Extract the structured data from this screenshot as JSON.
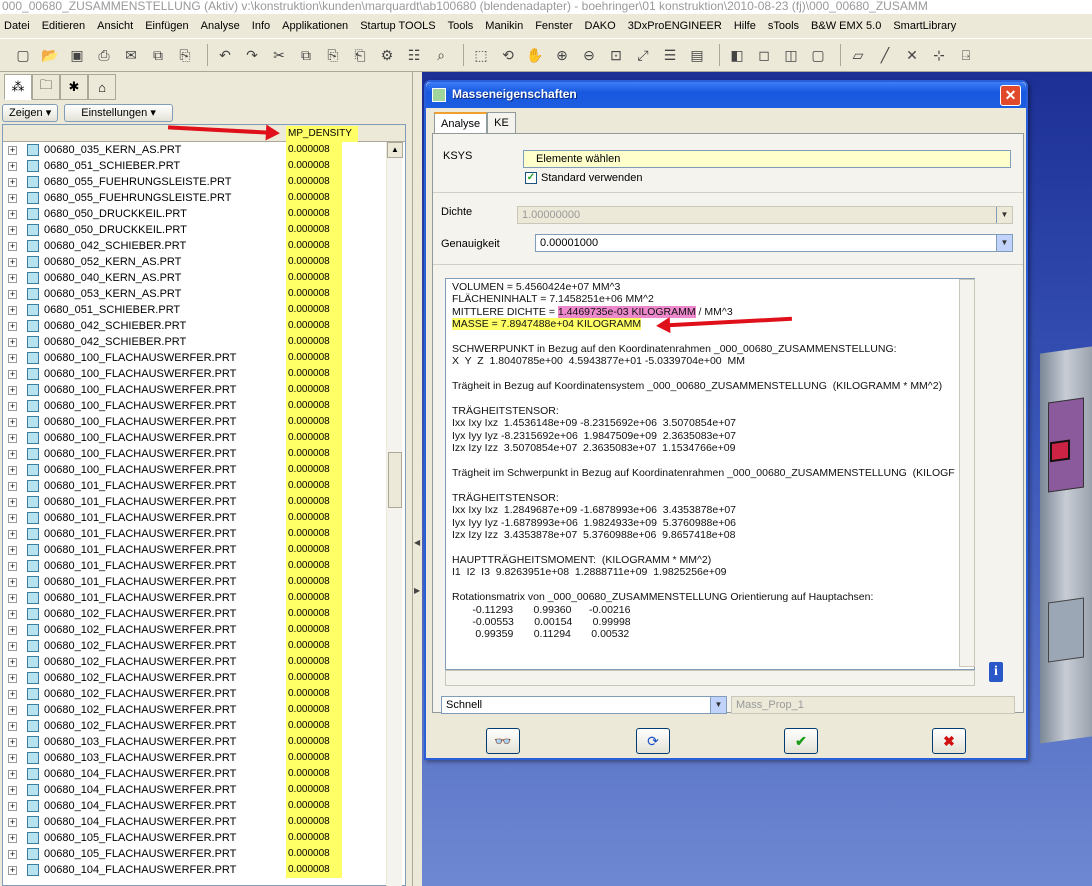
{
  "window": {
    "title": "000_00680_ZUSAMMENSTELLUNG (Aktiv) v:\\konstruktion\\kunden\\marquardt\\ab100680 (blendenadapter) - boehringer\\01 konstruktion\\2010-08-23 (fj)\\000_00680_ZUSAMM"
  },
  "menu": [
    "Datei",
    "Editieren",
    "Ansicht",
    "Einfügen",
    "Analyse",
    "Info",
    "Applikationen",
    "Startup TOOLS",
    "Tools",
    "Manikin",
    "Fenster",
    "DAKO",
    "3DxProENGINEER",
    "Hilfe",
    "sTools",
    "B&W EMX 5.0",
    "SmartLibrary"
  ],
  "toolbar_icons": [
    "new-icon",
    "open-icon",
    "save-icon",
    "print-icon",
    "send-icon",
    "copy-icon",
    "paste-icon",
    "undo-icon",
    "redo-icon",
    "cut-icon",
    "copy2-icon",
    "paste2-icon",
    "paste-special-icon",
    "regen-icon",
    "model-tree-icon",
    "binoculars-icon",
    "select-icon",
    "spin-icon",
    "pan-icon",
    "zoom-in-icon",
    "zoom-out-icon",
    "zoom-box-icon",
    "refit-icon",
    "layers-icon",
    "views-icon",
    "shading-icon",
    "wireframe-icon",
    "hidden-icon",
    "no-hidden-icon",
    "datum-plane-icon",
    "datum-axis-icon",
    "datum-point-icon",
    "csys-icon",
    "annotation-icon"
  ],
  "left": {
    "show_label": "Zeigen",
    "settings_label": "Einstellungen",
    "column_header": "MP_DENSITY",
    "rows": [
      {
        "name": "00680_035_KERN_AS.PRT",
        "value": "0.000008"
      },
      {
        "name": "0680_051_SCHIEBER.PRT",
        "value": "0.000008"
      },
      {
        "name": "0680_055_FUEHRUNGSLEISTE.PRT",
        "value": "0.000008"
      },
      {
        "name": "0680_055_FUEHRUNGSLEISTE.PRT",
        "value": "0.000008"
      },
      {
        "name": "0680_050_DRUCKKEIL.PRT",
        "value": "0.000008"
      },
      {
        "name": "0680_050_DRUCKKEIL.PRT",
        "value": "0.000008"
      },
      {
        "name": "00680_042_SCHIEBER.PRT",
        "value": "0.000008"
      },
      {
        "name": "00680_052_KERN_AS.PRT",
        "value": "0.000008"
      },
      {
        "name": "00680_040_KERN_AS.PRT",
        "value": "0.000008"
      },
      {
        "name": "00680_053_KERN_AS.PRT",
        "value": "0.000008"
      },
      {
        "name": "0680_051_SCHIEBER.PRT",
        "value": "0.000008"
      },
      {
        "name": "00680_042_SCHIEBER.PRT",
        "value": "0.000008"
      },
      {
        "name": "00680_042_SCHIEBER.PRT",
        "value": "0.000008"
      },
      {
        "name": "00680_100_FLACHAUSWERFER.PRT",
        "value": "0.000008"
      },
      {
        "name": "00680_100_FLACHAUSWERFER.PRT",
        "value": "0.000008"
      },
      {
        "name": "00680_100_FLACHAUSWERFER.PRT",
        "value": "0.000008"
      },
      {
        "name": "00680_100_FLACHAUSWERFER.PRT",
        "value": "0.000008"
      },
      {
        "name": "00680_100_FLACHAUSWERFER.PRT",
        "value": "0.000008"
      },
      {
        "name": "00680_100_FLACHAUSWERFER.PRT",
        "value": "0.000008"
      },
      {
        "name": "00680_100_FLACHAUSWERFER.PRT",
        "value": "0.000008"
      },
      {
        "name": "00680_100_FLACHAUSWERFER.PRT",
        "value": "0.000008"
      },
      {
        "name": "00680_101_FLACHAUSWERFER.PRT",
        "value": "0.000008"
      },
      {
        "name": "00680_101_FLACHAUSWERFER.PRT",
        "value": "0.000008"
      },
      {
        "name": "00680_101_FLACHAUSWERFER.PRT",
        "value": "0.000008"
      },
      {
        "name": "00680_101_FLACHAUSWERFER.PRT",
        "value": "0.000008"
      },
      {
        "name": "00680_101_FLACHAUSWERFER.PRT",
        "value": "0.000008"
      },
      {
        "name": "00680_101_FLACHAUSWERFER.PRT",
        "value": "0.000008"
      },
      {
        "name": "00680_101_FLACHAUSWERFER.PRT",
        "value": "0.000008"
      },
      {
        "name": "00680_101_FLACHAUSWERFER.PRT",
        "value": "0.000008"
      },
      {
        "name": "00680_102_FLACHAUSWERFER.PRT",
        "value": "0.000008"
      },
      {
        "name": "00680_102_FLACHAUSWERFER.PRT",
        "value": "0.000008"
      },
      {
        "name": "00680_102_FLACHAUSWERFER.PRT",
        "value": "0.000008"
      },
      {
        "name": "00680_102_FLACHAUSWERFER.PRT",
        "value": "0.000008"
      },
      {
        "name": "00680_102_FLACHAUSWERFER.PRT",
        "value": "0.000008"
      },
      {
        "name": "00680_102_FLACHAUSWERFER.PRT",
        "value": "0.000008"
      },
      {
        "name": "00680_102_FLACHAUSWERFER.PRT",
        "value": "0.000008"
      },
      {
        "name": "00680_102_FLACHAUSWERFER.PRT",
        "value": "0.000008"
      },
      {
        "name": "00680_103_FLACHAUSWERFER.PRT",
        "value": "0.000008"
      },
      {
        "name": "00680_103_FLACHAUSWERFER.PRT",
        "value": "0.000008"
      },
      {
        "name": "00680_104_FLACHAUSWERFER.PRT",
        "value": "0.000008"
      },
      {
        "name": "00680_104_FLACHAUSWERFER.PRT",
        "value": "0.000008"
      },
      {
        "name": "00680_104_FLACHAUSWERFER.PRT",
        "value": "0.000008"
      },
      {
        "name": "00680_104_FLACHAUSWERFER.PRT",
        "value": "0.000008"
      },
      {
        "name": "00680_105_FLACHAUSWERFER.PRT",
        "value": "0.000008"
      },
      {
        "name": "00680_105_FLACHAUSWERFER.PRT",
        "value": "0.000008"
      },
      {
        "name": "00680_104_FLACHAUSWERFER.PRT",
        "value": "0.000008"
      }
    ]
  },
  "dialog": {
    "title": "Masseneigenschaften",
    "tabs": [
      "Analyse",
      "KE"
    ],
    "ksys_label": "KSYS",
    "ksys_value": "Elemente wählen",
    "standard_label": "Standard verwenden",
    "dichte_label": "Dichte",
    "dichte_value": "1.00000000",
    "genauigkeit_label": "Genauigkeit",
    "genauigkeit_value": "0.00001000",
    "results": {
      "l1": "VOLUMEN = 5.4560424e+07 MM^3",
      "l2": "FLÄCHENINHALT = 7.1458251e+06 MM^2",
      "l3a": "MITTLERE DICHTE = ",
      "l3b": "1.4469735e-03 KILOGRAMM",
      "l3c": " / MM^3",
      "l4a": "MASSE = ",
      "l4b": "7.8947488e+04 KILOGRAMM",
      "l5": "",
      "l6": "SCHWERPUNKT in Bezug auf den Koordinatenrahmen _000_00680_ZUSAMMENSTELLUNG:",
      "l7": "X  Y  Z  1.8040785e+00  4.5943877e+01 -5.0339704e+00  MM",
      "l8": "",
      "l9": "Trägheit in Bezug auf Koordinatensystem _000_00680_ZUSAMMENSTELLUNG  (KILOGRAMM * MM^2)",
      "l10": "",
      "l11": "TRÄGHEITSTENSOR:",
      "l12": "Ixx Ixy Ixz  1.4536148e+09 -8.2315692e+06  3.5070854e+07",
      "l13": "Iyx Iyy Iyz -8.2315692e+06  1.9847509e+09  2.3635083e+07",
      "l14": "Izx Izy Izz  3.5070854e+07  2.3635083e+07  1.1534766e+09",
      "l15": "",
      "l16": "Trägheit im Schwerpunkt in Bezug auf Koordinatenrahmen _000_00680_ZUSAMMENSTELLUNG  (KILOGF",
      "l17": "",
      "l18": "TRÄGHEITSTENSOR:",
      "l19": "Ixx Ixy Ixz  1.2849687e+09 -1.6878993e+06  3.4353878e+07",
      "l20": "Iyx Iyy Iyz -1.6878993e+06  1.9824933e+09  5.3760988e+06",
      "l21": "Izx Izy Izz  3.4353878e+07  5.3760988e+06  9.8657418e+08",
      "l22": "",
      "l23": "HAUPTTRÄGHEITSMOMENT:  (KILOGRAMM * MM^2)",
      "l24": "I1  I2  I3  9.8263951e+08  1.2888711e+09  1.9825256e+09",
      "l25": "",
      "l26": "Rotationsmatrix von _000_00680_ZUSAMMENSTELLUNG Orientierung auf Hauptachsen:",
      "l27": "       -0.11293       0.99360      -0.00216",
      "l28": "       -0.00553       0.00154       0.99998",
      "l29": "        0.99359       0.11294       0.00532"
    },
    "mode_value": "Schnell",
    "name_value": "Mass_Prop_1"
  }
}
